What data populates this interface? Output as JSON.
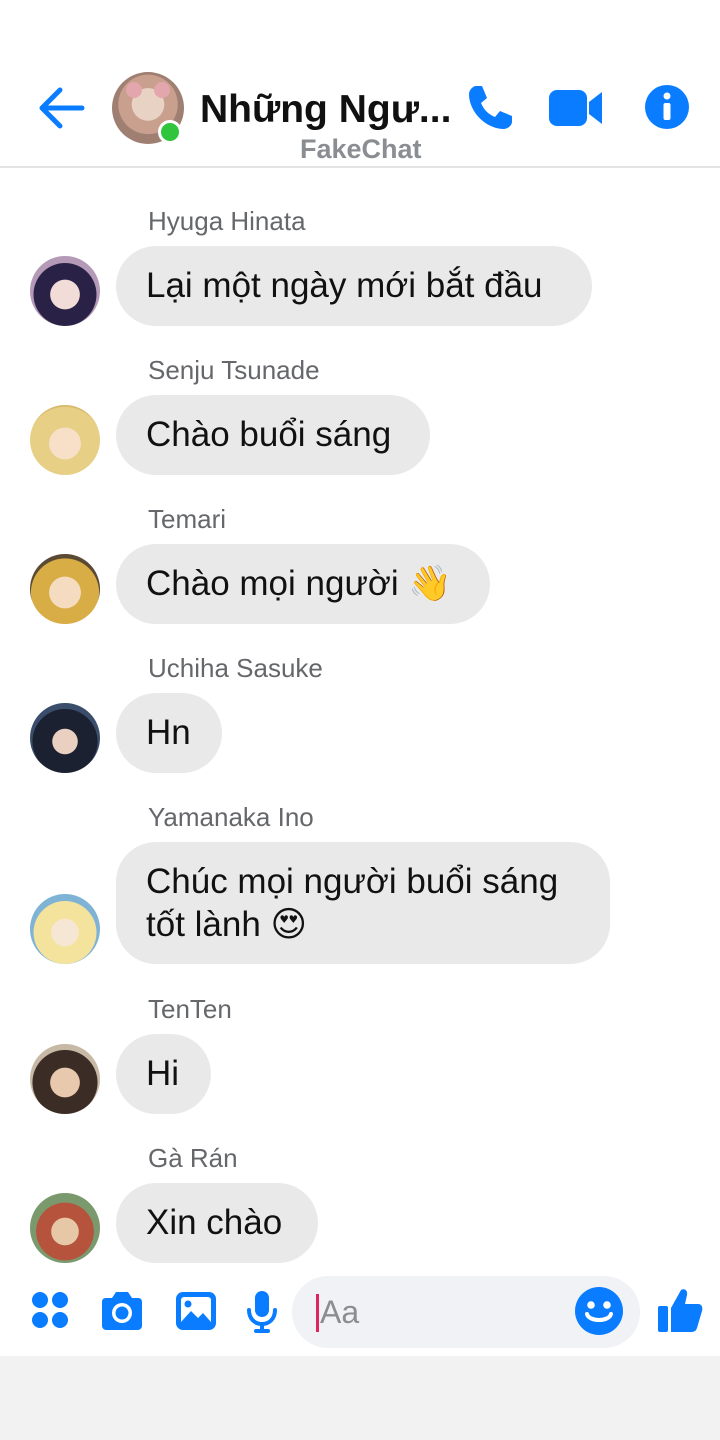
{
  "header": {
    "title": "Những Ngư...",
    "subtitle": "FakeChat",
    "accent_color": "#0a7cff",
    "online_color": "#31c53e",
    "icons": [
      "back-arrow-icon",
      "phone-icon",
      "video-camera-icon",
      "info-icon"
    ]
  },
  "messages": [
    {
      "sender": "Hyuga Hinata",
      "text": "Lại một ngày mới bắt đầu"
    },
    {
      "sender": "Senju Tsunade",
      "text": "Chào buổi sáng"
    },
    {
      "sender": "Temari",
      "text": "Chào mọi người",
      "emoji": "👋"
    },
    {
      "sender": "Uchiha Sasuke",
      "text": "Hn"
    },
    {
      "sender": "Yamanaka Ino",
      "text_line1": "Chúc mọi người buổi sáng",
      "text_line2": "tốt lành",
      "emoji": "😍"
    },
    {
      "sender": "TenTen",
      "text": "Hi"
    },
    {
      "sender": "Gà Rán",
      "text": "Xin chào"
    }
  ],
  "composer": {
    "placeholder": "Aa",
    "icons": [
      "apps-grid-icon",
      "camera-icon",
      "gallery-icon",
      "microphone-icon",
      "emoji-smile-icon",
      "thumbs-up-icon"
    ]
  }
}
